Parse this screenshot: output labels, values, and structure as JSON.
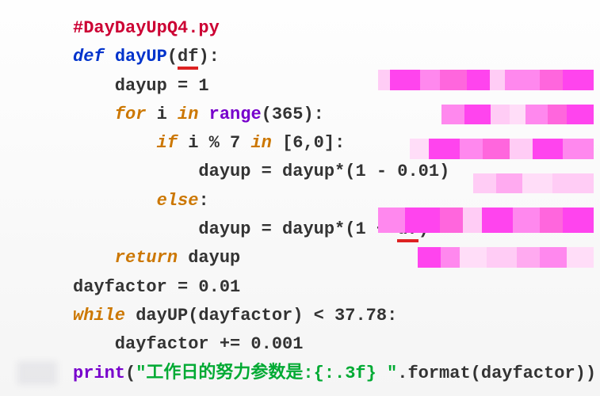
{
  "code": {
    "l1_comment": "#DayDayUpQ4.py",
    "l2_def": "def ",
    "l2_func": "dayUP",
    "l2_open": "(",
    "l2_param": "df",
    "l2_close": "):",
    "l3": "    dayup = 1",
    "l4_for": "    for ",
    "l4_var": "i ",
    "l4_in": "in ",
    "l4_range": "range",
    "l4_args": "(365):",
    "l5_if": "        if ",
    "l5_cond": "i % 7 ",
    "l5_in": "in ",
    "l5_list": "[6,0]:",
    "l6": "            dayup = dayup*(1 - 0.01)",
    "l7_else": "        else",
    "l7_colon": ":",
    "l8_pre": "            dayup = dayup*(1 + ",
    "l8_df": "df",
    "l8_post": ")",
    "l9_return": "    return ",
    "l9_val": "dayup",
    "l10": "dayfactor = 0.01",
    "l11_while": "while ",
    "l11_cond": "dayUP(dayfactor) < 37.78:",
    "l12": "    dayfactor += 0.001",
    "l13_print": "print",
    "l13_open": "(",
    "l13_str": "\"工作日的努力参数是:{:.3f} \"",
    "l13_rest": ".format(dayfactor))"
  }
}
